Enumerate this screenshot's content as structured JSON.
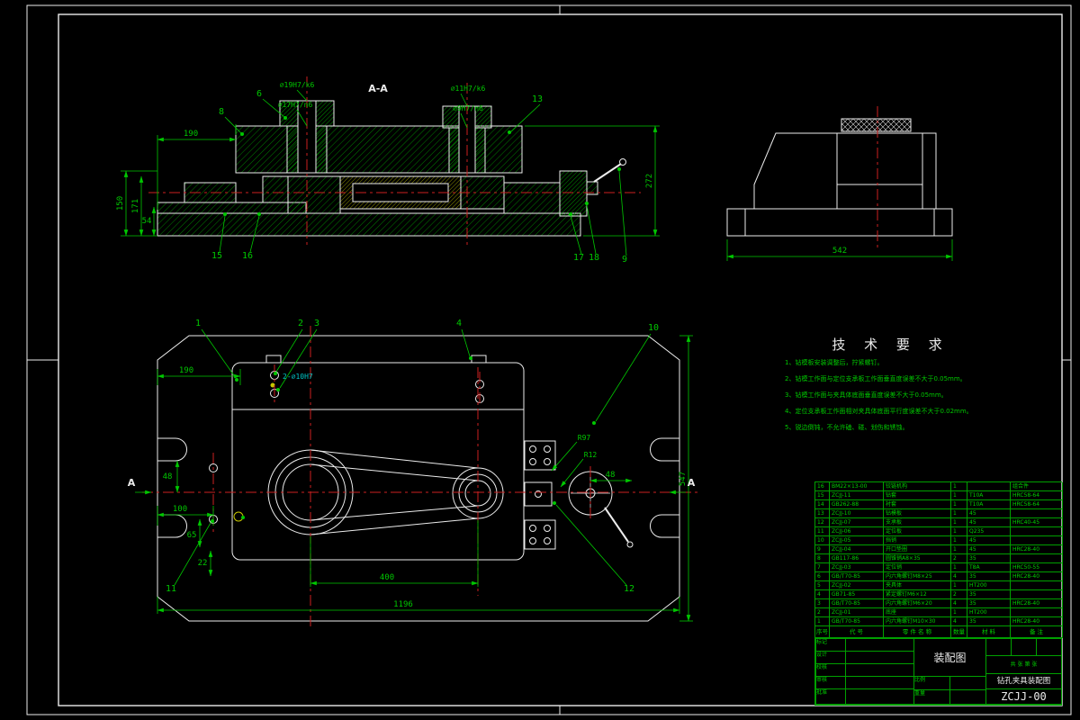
{
  "colors": {
    "bg": "#000000",
    "line": "#ececec",
    "dim": "#00c800",
    "center": "#cc2020",
    "yellow": "#c8c800",
    "cyan": "#00c8c8"
  },
  "front_view": {
    "section_label": "A-A",
    "labels": {
      "bush_l1": "∅19H7/k6",
      "bush_l2": "∅17H7/n6",
      "bush_r1": "∅11H7/k6",
      "bush_r2": "∅9H7/n6"
    },
    "dims": {
      "w190": "190",
      "h150": "150",
      "h171": "171",
      "h54": "54",
      "h272": "272"
    },
    "balloons": {
      "b6": "6",
      "b8": "8",
      "b13": "13",
      "b15": "15",
      "b16": "16",
      "b17": "17",
      "b18": "18",
      "b9": "9"
    }
  },
  "side_view": {
    "dims": {
      "w542": "542"
    }
  },
  "plan_view": {
    "labels": {
      "hole_note": "2-∅10H7",
      "r97": "R97",
      "r12": "R12",
      "sec_a_l": "A",
      "sec_a_r": "A"
    },
    "dims": {
      "w190": "190",
      "w100": "100",
      "h48": "48",
      "h65": "65",
      "h22": "22",
      "w400": "400",
      "w1196": "1196",
      "h547": "547",
      "w48": "48"
    },
    "balloons": {
      "b1": "1",
      "b2": "2",
      "b3": "3",
      "b4": "4",
      "b10": "10",
      "b11": "11",
      "b12": "12"
    }
  },
  "tech_req": {
    "title": "技 术 要 求",
    "items": [
      "1、钻模板安装调整后，拧紧螺钉。",
      "2、钻模工作面与定位支承板工作面垂直度误差不大于0.05mm。",
      "3、钻模工作面与夹具体底面垂直度误差不大于0.05mm。",
      "4、定位支承板工作面相对夹具体底面平行度误差不大于0.02mm。",
      "5、锐边倒钝，不允许磕、碰、划伤和锈蚀。"
    ]
  },
  "bom": {
    "header": {
      "no": "序号",
      "code": "代  号",
      "name": "零 件 名 称",
      "qty": "数量",
      "mat": "材  料",
      "rem": "备  注"
    },
    "rows": [
      {
        "no": "16",
        "code": "BM22×13-00",
        "name": "铰链机构",
        "qty": "1",
        "mat": "",
        "rem": "组合件"
      },
      {
        "no": "15",
        "code": "ZCJJ-11",
        "name": "钻套",
        "qty": "1",
        "mat": "T10A",
        "rem": "HRC58-64"
      },
      {
        "no": "14",
        "code": "GB262-88",
        "name": "衬套",
        "qty": "1",
        "mat": "T10A",
        "rem": "HRC58-64"
      },
      {
        "no": "13",
        "code": "ZCJJ-10",
        "name": "钻模板",
        "qty": "1",
        "mat": "45",
        "rem": ""
      },
      {
        "no": "12",
        "code": "ZCJJ-07",
        "name": "支承板",
        "qty": "1",
        "mat": "45",
        "rem": "HRC40-45"
      },
      {
        "no": "11",
        "code": "ZCJJ-06",
        "name": "定位板",
        "qty": "1",
        "mat": "Q235",
        "rem": ""
      },
      {
        "no": "10",
        "code": "ZCJJ-05",
        "name": "挡销",
        "qty": "1",
        "mat": "45",
        "rem": ""
      },
      {
        "no": "9",
        "code": "ZCJJ-04",
        "name": "开口垫圈",
        "qty": "1",
        "mat": "45",
        "rem": "HRC28-40"
      },
      {
        "no": "8",
        "code": "GB117-86",
        "name": "圆锥销A8×35",
        "qty": "2",
        "mat": "35",
        "rem": ""
      },
      {
        "no": "7",
        "code": "ZCJJ-03",
        "name": "定位销",
        "qty": "1",
        "mat": "T8A",
        "rem": "HRC50-55"
      },
      {
        "no": "6",
        "code": "GB/T70-85",
        "name": "内六角螺钉M8×25",
        "qty": "4",
        "mat": "35",
        "rem": "HRC28-40"
      },
      {
        "no": "5",
        "code": "ZCJJ-02",
        "name": "夹具体",
        "qty": "1",
        "mat": "HT200",
        "rem": ""
      },
      {
        "no": "4",
        "code": "GB71-85",
        "name": "紧定螺钉M6×12",
        "qty": "2",
        "mat": "35",
        "rem": ""
      },
      {
        "no": "3",
        "code": "GB/T70-85",
        "name": "内六角螺钉M6×20",
        "qty": "4",
        "mat": "35",
        "rem": "HRC28-40"
      },
      {
        "no": "2",
        "code": "ZCJJ-01",
        "name": "底座",
        "qty": "1",
        "mat": "HT200",
        "rem": ""
      },
      {
        "no": "1",
        "code": "GB/T70-85",
        "name": "内六角螺钉M10×30",
        "qty": "4",
        "mat": "35",
        "rem": "HRC28-40"
      }
    ]
  },
  "title_block": {
    "type_label": "装配图",
    "name": "钻孔夹具装配图",
    "code": "ZCJJ-00",
    "left_labels": [
      "标记",
      "设计",
      "校核",
      "审核",
      "批准"
    ],
    "scale_label": "比例",
    "weight_label": "重量",
    "sheet_label": "共 张 第 张"
  }
}
